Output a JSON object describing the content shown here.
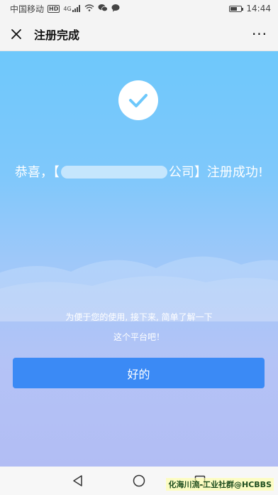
{
  "status_bar": {
    "carrier": "中国移动",
    "hd": "HD",
    "signal": "4G",
    "time": "14:44",
    "battery_level": 0.6
  },
  "nav": {
    "title": "注册完成",
    "more": "···"
  },
  "main": {
    "congrats_prefix": "恭喜，【",
    "congrats_suffix": "公司】注册成功!",
    "intro_line1": "为便于您的使用, 接下来, 简单了解一下",
    "intro_line2": "这个平台吧！",
    "ok_button": "好的"
  },
  "watermark": "化海川流-工业社群@HCBBS",
  "colors": {
    "accent": "#3b8af5",
    "background_top": "#6ec8fb",
    "background_bottom": "#b2bdf4"
  }
}
